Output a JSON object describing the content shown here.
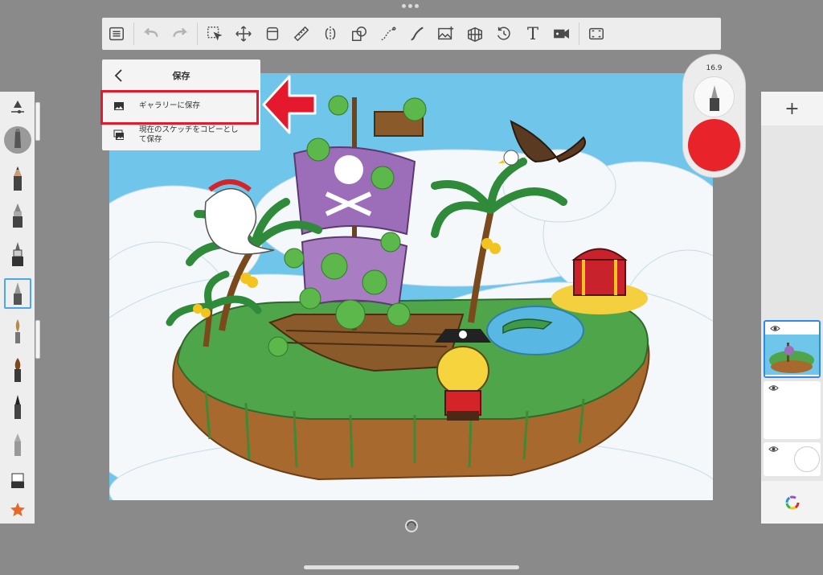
{
  "toolbar": {
    "tools": [
      "list-icon",
      "undo-icon",
      "redo-icon",
      "selection-icon",
      "transform-icon",
      "layer-editor-icon",
      "ruler-icon",
      "symmetry-icon",
      "shape-icon",
      "curve-icon",
      "stroke-icon",
      "image-import-icon",
      "perspective-icon",
      "time-lapse-icon",
      "text-tool",
      "video-icon",
      "fullscreen-icon"
    ],
    "text_tool_label": "T"
  },
  "save_menu": {
    "title": "保存",
    "items": [
      {
        "label": "ギャラリーに保存",
        "icon": "image-icon"
      },
      {
        "label": "現在のスケッチをコピーとして保存",
        "label_line1": "現在のスケッチをコピーとし",
        "label_line2": "て保存",
        "icon": "copy-image-icon"
      }
    ]
  },
  "brush": {
    "size": "16.9",
    "color": "#e8242a"
  },
  "left_brushes": [
    "brush-options-icon",
    "blender-icon",
    "pencil-icon",
    "marker-icon",
    "technical-pen-icon",
    "ballpoint-pen-icon",
    "airbrush-icon",
    "paintbrush-icon",
    "ink-pen-icon",
    "chisel-icon",
    "felt-tip-icon",
    "eraser-icon",
    "favorites-star-icon"
  ],
  "layers": {
    "add_label": "+",
    "items": [
      {
        "name": "layer-1",
        "selected": true
      },
      {
        "name": "layer-2",
        "selected": false
      },
      {
        "name": "background-layer",
        "selected": false
      }
    ]
  },
  "colors": {
    "highlight": "#e5192d",
    "accent": "#2f8be6",
    "sky": "#6fc5ea"
  }
}
